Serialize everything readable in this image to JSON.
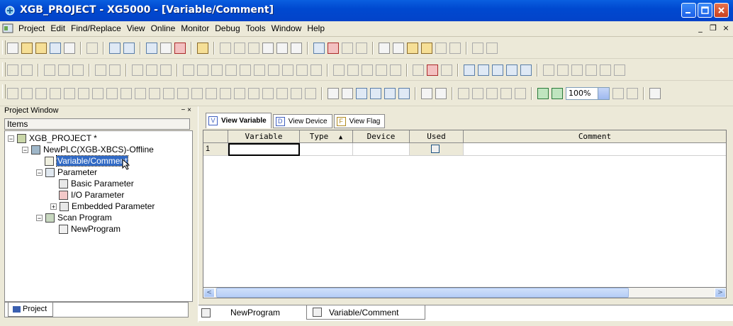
{
  "window": {
    "title": "XGB_PROJECT - XG5000 - [Variable/Comment]"
  },
  "menu": {
    "items": [
      "Project",
      "Edit",
      "Find/Replace",
      "View",
      "Online",
      "Monitor",
      "Debug",
      "Tools",
      "Window",
      "Help"
    ],
    "mdi_controls": [
      "_",
      "❒",
      "×"
    ]
  },
  "toolbar": {
    "zoom_value": "100%"
  },
  "project_window": {
    "title": "Project Window",
    "pin_label": "− ×",
    "items_label": "Items",
    "tree": [
      {
        "label": "XGB_PROJECT *"
      },
      {
        "label": "NewPLC(XGB-XBCS)-Offline"
      },
      {
        "label": "Variable/Comment"
      },
      {
        "label": "Parameter"
      },
      {
        "label": "Basic Parameter"
      },
      {
        "label": "I/O Parameter"
      },
      {
        "label": "Embedded Parameter"
      },
      {
        "label": "Scan Program"
      },
      {
        "label": "NewProgram"
      }
    ],
    "tab_label": "Project"
  },
  "editor": {
    "view_tabs": [
      {
        "label": "View Variable",
        "icon": "V"
      },
      {
        "label": "View Device",
        "icon": "D"
      },
      {
        "label": "View Flag",
        "icon": "F"
      }
    ],
    "columns": [
      "Variable",
      "Type",
      "Device",
      "Used",
      "Comment"
    ],
    "sort_indicator": "▲",
    "rows": [
      {
        "num": "1",
        "variable": "",
        "type": "",
        "device": "",
        "used": false,
        "comment": ""
      }
    ],
    "scroll": {
      "left": "<",
      "right": ">"
    },
    "bottom_tabs": [
      {
        "label": "NewProgram"
      },
      {
        "label": "Variable/Comment"
      }
    ]
  }
}
